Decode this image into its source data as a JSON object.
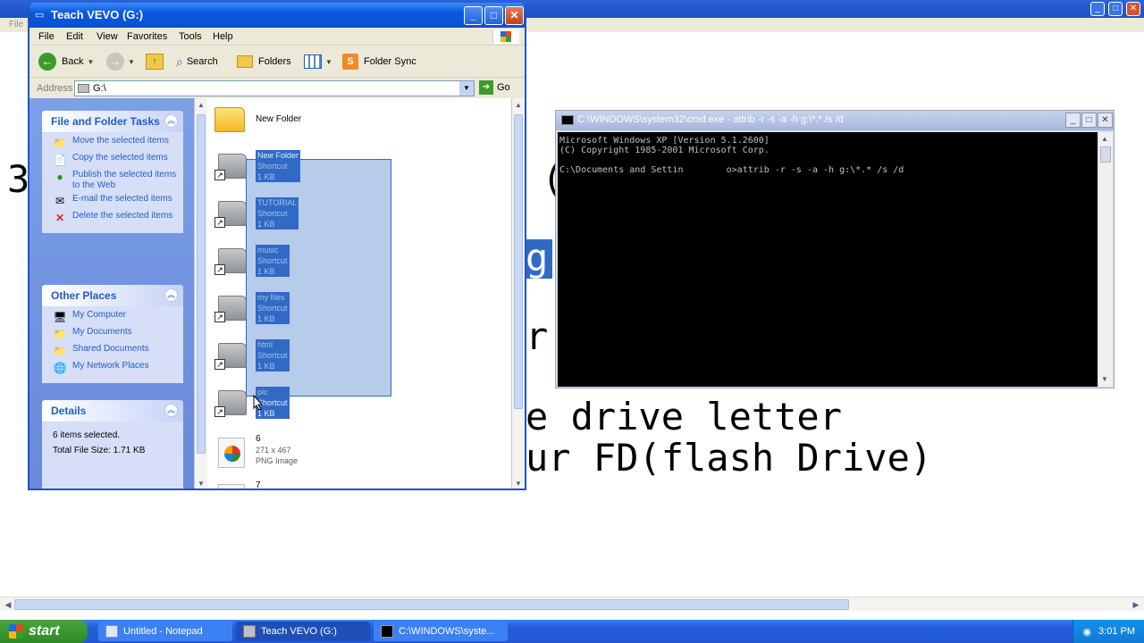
{
  "notepad": {
    "menu_first": "File",
    "canvas_lines": [
      {
        "text": "3"
      },
      {
        "text": "("
      },
      {
        "text": "g"
      },
      {
        "text": "r"
      },
      {
        "text": "e drive letter"
      },
      {
        "text": "ur FD(flash Drive)"
      }
    ]
  },
  "explorer": {
    "title": "Teach VEVO (G:)",
    "menu": [
      "File",
      "Edit",
      "View",
      "Favorites",
      "Tools",
      "Help"
    ],
    "toolbar": {
      "back": "Back",
      "search": "Search",
      "folders": "Folders",
      "folder_sync": "Folder Sync"
    },
    "address": {
      "label": "Address",
      "value": "G:\\",
      "go": "Go"
    },
    "tasks_panel": {
      "title": "File and Folder Tasks",
      "items": [
        "Move the selected items",
        "Copy the selected items",
        "Publish the selected items to the Web",
        "E-mail the selected items",
        "Delete the selected items"
      ]
    },
    "places_panel": {
      "title": "Other Places",
      "items": [
        "My Computer",
        "My Documents",
        "Shared Documents",
        "My Network Places"
      ]
    },
    "details_panel": {
      "title": "Details",
      "count": "6 items selected.",
      "size": "Total File Size: 1.71 KB"
    },
    "files": [
      {
        "name": "New Folder",
        "type": "",
        "size": "",
        "kind": "folder",
        "selected": false
      },
      {
        "name": "New Folder",
        "type": "Shortcut",
        "size": "1 KB",
        "kind": "shortcut",
        "selected": true
      },
      {
        "name": "TUTORIAL",
        "type": "Shortcut",
        "size": "1 KB",
        "kind": "shortcut",
        "selected": true
      },
      {
        "name": "music",
        "type": "Shortcut",
        "size": "1 KB",
        "kind": "shortcut",
        "selected": true
      },
      {
        "name": "my files",
        "type": "Shortcut",
        "size": "1 KB",
        "kind": "shortcut",
        "selected": true
      },
      {
        "name": "html",
        "type": "Shortcut",
        "size": "1 KB",
        "kind": "shortcut",
        "selected": true
      },
      {
        "name": "pic",
        "type": "Shortcut",
        "size": "1 KB",
        "kind": "shortcut",
        "selected": true
      },
      {
        "name": "6",
        "type": "271 x 467",
        "size": "PNG Image",
        "kind": "png",
        "selected": false
      },
      {
        "name": "7",
        "type": "",
        "size": "",
        "kind": "png",
        "selected": false
      }
    ]
  },
  "cmd": {
    "title": "C:\\WINDOWS\\system32\\cmd.exe - attrib -r -s -a -h g:\\*.* /s /d",
    "lines": [
      "Microsoft Windows XP [Version 5.1.2600]",
      "(C) Copyright 1985-2001 Microsoft Corp.",
      "",
      "C:\\Documents and Settin        o>attrib -r -s -a -h g:\\*.* /s /d"
    ]
  },
  "taskbar": {
    "start": "start",
    "items": [
      "Untitled - Notepad",
      "Teach VEVO (G:)",
      "C:\\WINDOWS\\syste..."
    ],
    "clock": "3:01 PM"
  },
  "colors": {
    "xp_blue": "#0b4fd3",
    "selection": "#316ac5",
    "task_link": "#215dc6",
    "start_green": "#2e8a24"
  }
}
